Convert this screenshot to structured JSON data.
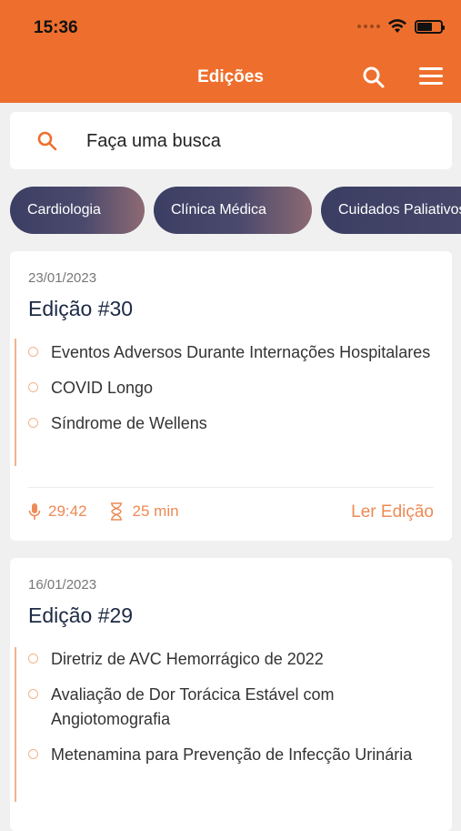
{
  "status": {
    "time": "15:36"
  },
  "header": {
    "title": "Edições"
  },
  "search": {
    "placeholder": "Faça uma busca"
  },
  "categories": [
    {
      "label": "Cardiologia"
    },
    {
      "label": "Clínica Médica"
    },
    {
      "label": "Cuidados Paliativos"
    }
  ],
  "editions": [
    {
      "date": "23/01/2023",
      "title": "Edição #30",
      "topics": [
        "Eventos Adversos Durante Internações Hospitalares",
        "COVID Longo",
        "Síndrome de Wellens"
      ],
      "audio_duration": "29:42",
      "reading_time": "25 min",
      "read_label": "Ler Edição"
    },
    {
      "date": "16/01/2023",
      "title": "Edição #29",
      "topics": [
        "Diretriz de AVC Hemorrágico de 2022",
        "Avaliação de Dor Torácica Estável com Angiotomografia",
        "Metenamina para Prevenção de Infecção Urinária"
      ]
    }
  ],
  "colors": {
    "brand": "#ee6f2d",
    "accent": "#ee8a55",
    "title_text": "#1d2a44"
  }
}
